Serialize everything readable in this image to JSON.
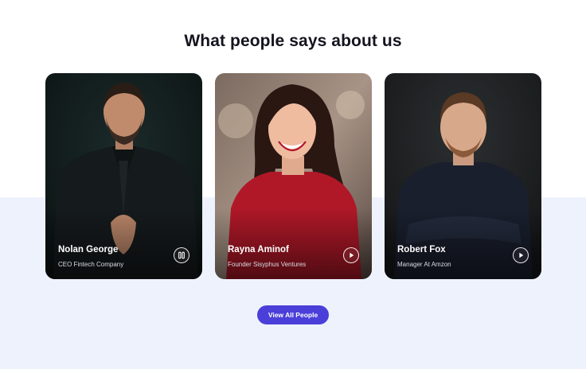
{
  "section": {
    "title": "What people says about us"
  },
  "testimonials": [
    {
      "name": "Nolan George",
      "role": "CEO Fintech Company",
      "media_state": "paused",
      "control_icon": "pause-icon"
    },
    {
      "name": "Rayna Aminof",
      "role": "Founder Sisyphus Ventures",
      "media_state": "stopped",
      "control_icon": "play-icon"
    },
    {
      "name": "Robert Fox",
      "role": "Manager At Amzon",
      "media_state": "stopped",
      "control_icon": "play-icon"
    }
  ],
  "cta": {
    "label": "View All People"
  },
  "colors": {
    "accent": "#4b3fd9",
    "lower_background": "#eef2fd",
    "title_text": "#14141f"
  }
}
